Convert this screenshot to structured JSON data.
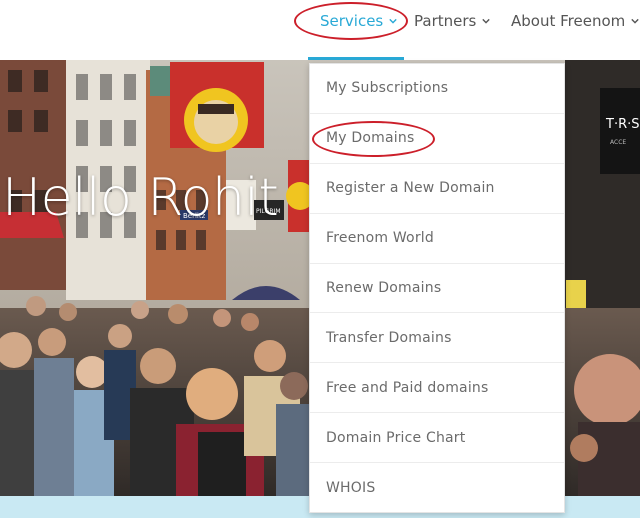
{
  "nav": {
    "items": [
      {
        "label": "Services"
      },
      {
        "label": "Partners"
      },
      {
        "label": "About Freenom"
      }
    ]
  },
  "hero": {
    "greeting": "Hello Rohit",
    "signs": {
      "berlitz": "Berlitz",
      "pilgrim": "PILGRIM",
      "trs": "T·R·S",
      "acce": "ACCE"
    }
  },
  "dropdown": {
    "items": [
      {
        "label": "My Subscriptions"
      },
      {
        "label": "My Domains"
      },
      {
        "label": "Register a New Domain"
      },
      {
        "label": "Freenom World"
      },
      {
        "label": "Renew Domains"
      },
      {
        "label": "Transfer Domains"
      },
      {
        "label": "Free and Paid domains"
      },
      {
        "label": "Domain Price Chart"
      },
      {
        "label": "WHOIS"
      }
    ]
  },
  "colors": {
    "accent": "#29a9d6",
    "annotation": "#cc1f2a",
    "strip": "#c9e9f3"
  }
}
